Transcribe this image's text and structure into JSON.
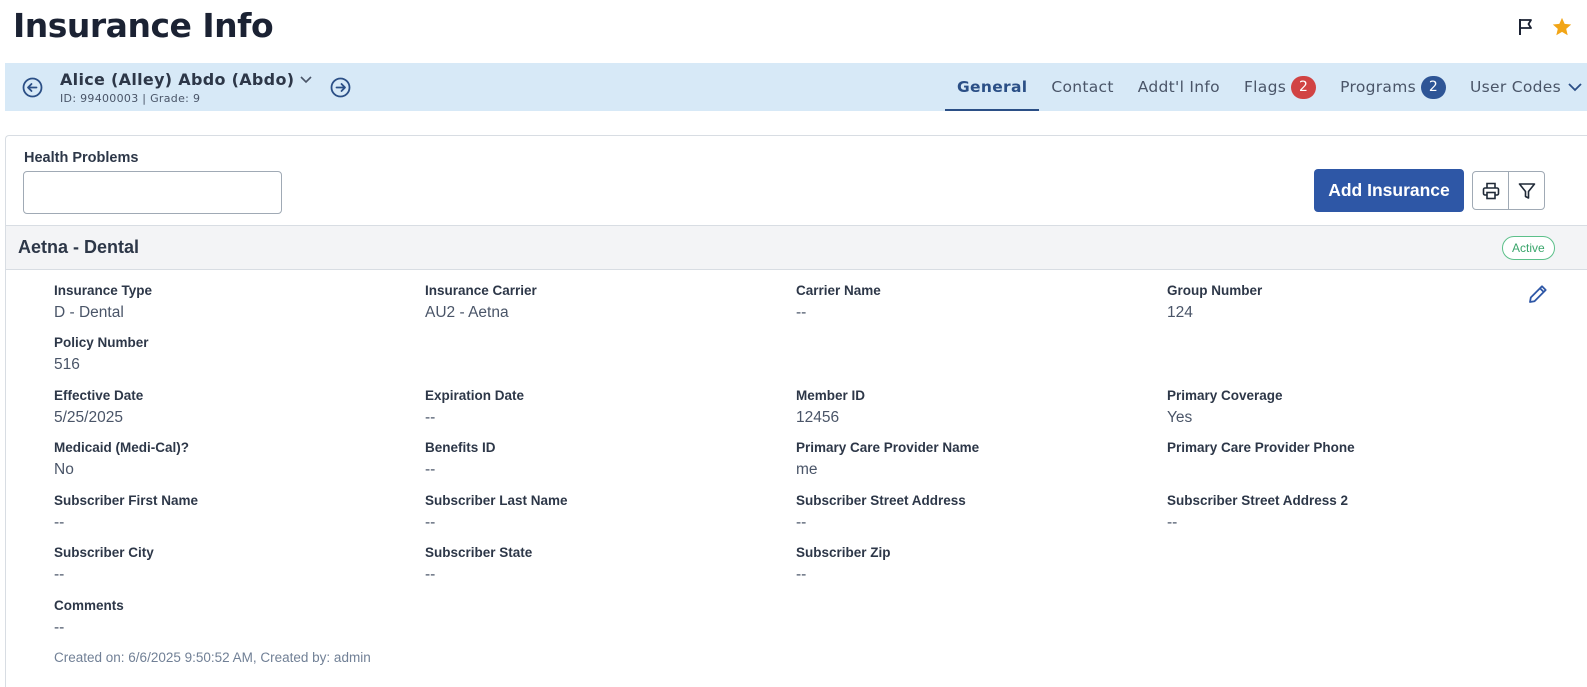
{
  "page": {
    "title": "Insurance Info"
  },
  "header_icons": {
    "flag": "flag-icon",
    "star": "star-icon",
    "star_color": "#f2a516"
  },
  "student": {
    "name": "Alice (Alley) Abdo (Abdo)",
    "meta": "ID: 99400003 |  Grade: 9"
  },
  "tabs": [
    {
      "label": "General",
      "active": true
    },
    {
      "label": "Contact"
    },
    {
      "label": "Addt'l Info"
    },
    {
      "label": "Flags",
      "badge": "2",
      "badge_color": "#d14343"
    },
    {
      "label": "Programs",
      "badge": "2",
      "badge_color": "#2e5596"
    },
    {
      "label": "User Codes",
      "dropdown": true
    }
  ],
  "health": {
    "label": "Health Problems",
    "value": ""
  },
  "toolbar": {
    "add_label": "Add Insurance",
    "print_icon": "print-icon",
    "filter_icon": "filter-icon"
  },
  "insurance": {
    "title": "Aetna - Dental",
    "status": "Active",
    "fields": {
      "insurance_type": {
        "label": "Insurance Type",
        "value": "D - Dental"
      },
      "insurance_carrier": {
        "label": "Insurance Carrier",
        "value": "AU2 - Aetna"
      },
      "carrier_name": {
        "label": "Carrier Name",
        "value": "--"
      },
      "group_number": {
        "label": "Group Number",
        "value": "124"
      },
      "policy_number": {
        "label": "Policy Number",
        "value": "516"
      },
      "effective_date": {
        "label": "Effective Date",
        "value": "5/25/2025"
      },
      "expiration_date": {
        "label": "Expiration Date",
        "value": "--"
      },
      "member_id": {
        "label": "Member ID",
        "value": "12456"
      },
      "primary_coverage": {
        "label": "Primary Coverage",
        "value": "Yes"
      },
      "medicaid": {
        "label": "Medicaid (Medi-Cal)?",
        "value": "No"
      },
      "benefits_id": {
        "label": "Benefits ID",
        "value": "--"
      },
      "pcp_name": {
        "label": "Primary Care Provider Name",
        "value": "me"
      },
      "pcp_phone": {
        "label": "Primary Care Provider Phone",
        "value": ""
      },
      "sub_first": {
        "label": "Subscriber First Name",
        "value": "--"
      },
      "sub_last": {
        "label": "Subscriber Last Name",
        "value": "--"
      },
      "sub_street": {
        "label": "Subscriber Street Address",
        "value": "--"
      },
      "sub_street2": {
        "label": "Subscriber Street Address 2",
        "value": "--"
      },
      "sub_city": {
        "label": "Subscriber City",
        "value": "--"
      },
      "sub_state": {
        "label": "Subscriber State",
        "value": "--"
      },
      "sub_zip": {
        "label": "Subscriber Zip",
        "value": "--"
      },
      "comments": {
        "label": "Comments",
        "value": "--"
      }
    },
    "footer": "Created on: 6/6/2025 9:50:52 AM, Created by: admin"
  },
  "colors": {
    "accent": "#2e57a6",
    "bar_bg": "#d7e9f7",
    "active_green": "#3aa56b"
  }
}
